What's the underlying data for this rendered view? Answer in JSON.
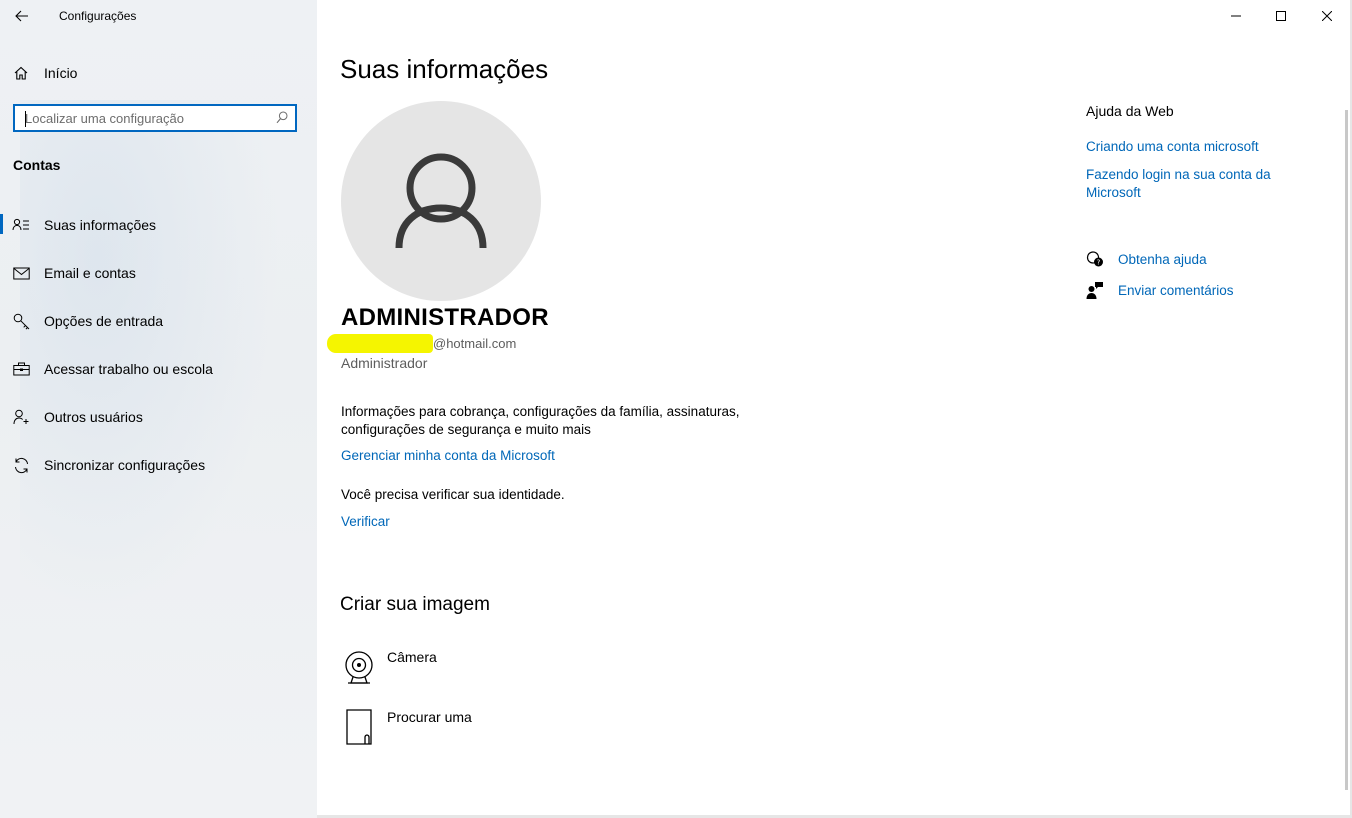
{
  "window": {
    "title": "Configurações",
    "controls": [
      "minimize-icon",
      "maximize-icon",
      "close-icon"
    ]
  },
  "sidebar": {
    "home_label": "Início",
    "search_placeholder": "Localizar uma configuração",
    "section_title": "Contas",
    "items": [
      {
        "label": "Suas informações",
        "icon": "person-list-icon",
        "active": true
      },
      {
        "label": "Email e contas",
        "icon": "mail-icon",
        "active": false
      },
      {
        "label": "Opções de entrada",
        "icon": "key-icon",
        "active": false
      },
      {
        "label": "Acessar trabalho ou escola",
        "icon": "briefcase-icon",
        "active": false
      },
      {
        "label": "Outros usuários",
        "icon": "person-add-icon",
        "active": false
      },
      {
        "label": "Sincronizar configurações",
        "icon": "sync-icon",
        "active": false
      }
    ]
  },
  "main": {
    "title": "Suas informações",
    "user_name": "ADMINISTRADOR",
    "email_suffix": "@hotmail.com",
    "role": "Administrador",
    "account_description": "Informações para cobrança, configurações da família, assinaturas, configurações de segurança e muito mais",
    "manage_link": "Gerenciar minha conta da Microsoft",
    "verify_text": "Você precisa verificar sua identidade.",
    "verify_link": "Verificar",
    "create_image_title": "Criar sua imagem",
    "image_options": [
      {
        "label": "Câmera",
        "icon": "camera-icon"
      },
      {
        "label": "Procurar uma",
        "icon": "browse-file-icon"
      }
    ]
  },
  "help_panel": {
    "title": "Ajuda da Web",
    "links": [
      "Criando uma conta microsoft",
      "Fazendo login na sua conta da Microsoft"
    ],
    "get_help": "Obtenha ajuda",
    "send_feedback": "Enviar comentários"
  },
  "colors": {
    "accent": "#0067b8",
    "highlight": "#f5f500",
    "sidebar_bg": "#eef1f4"
  }
}
